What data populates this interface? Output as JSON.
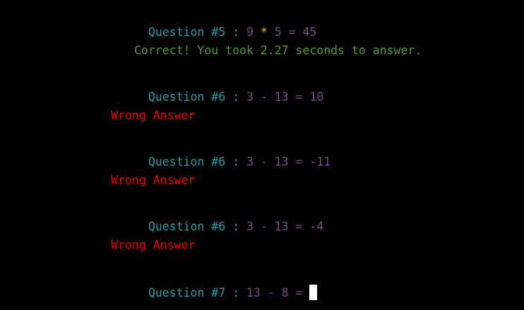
{
  "lines": [
    {
      "type": "question",
      "label": "Question #5",
      "sep": ":",
      "a": "9",
      "op": "*",
      "b": "5",
      "eq": "=",
      "answer": "45"
    },
    {
      "type": "result",
      "text": "Correct! You took 2.27 seconds to answer."
    },
    {
      "type": "question",
      "label": "Question #6",
      "sep": ":",
      "a": "3",
      "op": "-",
      "b": "13",
      "eq": "=",
      "answer": "10"
    },
    {
      "type": "wrong",
      "text": "Wrong Answer"
    },
    {
      "type": "question",
      "label": "Question #6",
      "sep": ":",
      "a": "3",
      "op": "-",
      "b": "13",
      "eq": "=",
      "answer": "-11"
    },
    {
      "type": "wrong",
      "text": "Wrong Answer"
    },
    {
      "type": "question",
      "label": "Question #6",
      "sep": ":",
      "a": "3",
      "op": "-",
      "b": "13",
      "eq": "=",
      "answer": "-4"
    },
    {
      "type": "wrong",
      "text": "Wrong Answer"
    },
    {
      "type": "question",
      "label": "Question #7",
      "sep": ":",
      "a": "13",
      "op": "-",
      "b": "8",
      "eq": "=",
      "answer": ""
    }
  ],
  "colors": {
    "background": "#000000",
    "question_label": "#1f9ea3",
    "numbers": "#7b4a8a",
    "multiply_operator": "#e5c100",
    "correct": "#4c9a2a",
    "wrong": "#e00000",
    "cursor": "#ffffff"
  }
}
